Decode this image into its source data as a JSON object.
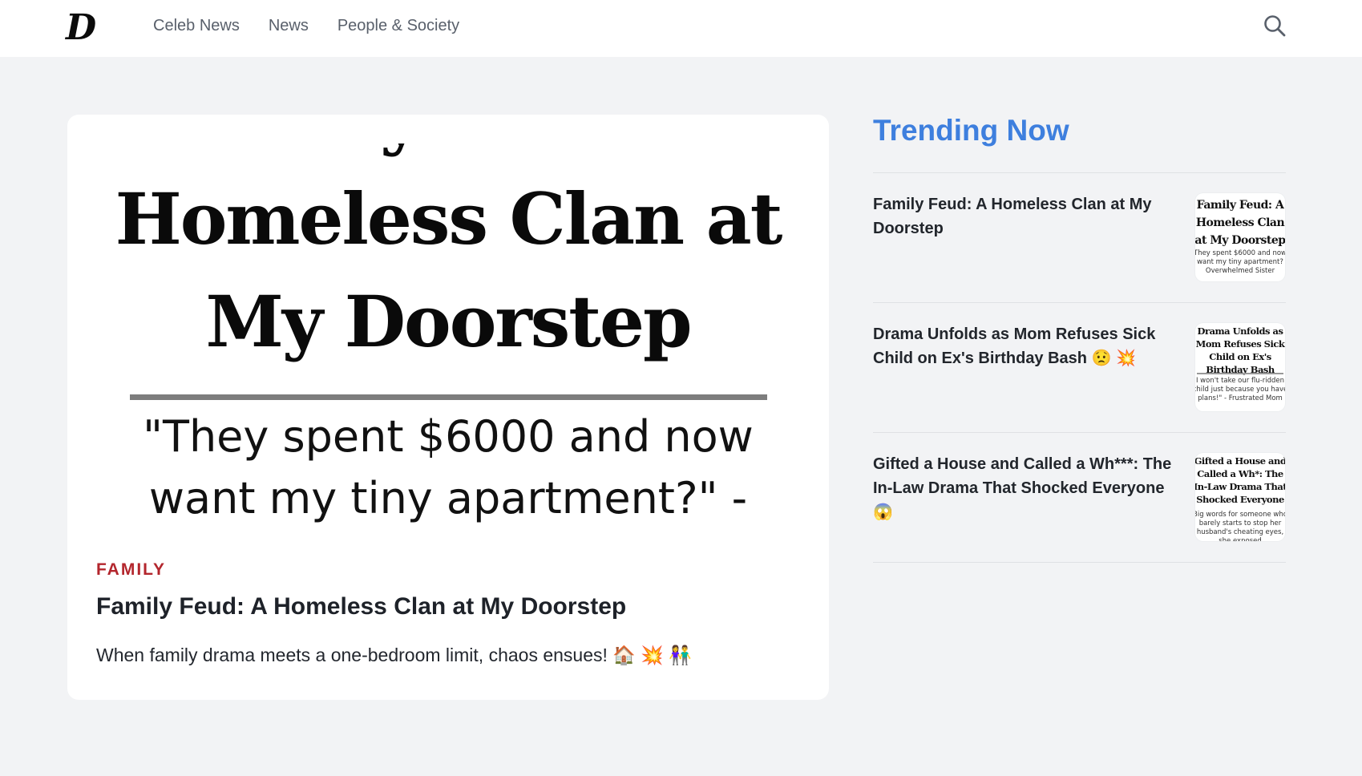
{
  "header": {
    "logo_text": "D",
    "nav": [
      {
        "label": "Celeb News"
      },
      {
        "label": "News"
      },
      {
        "label": "People & Society"
      }
    ],
    "search_icon": "search-icon"
  },
  "featured": {
    "hero": {
      "title": "Family Feud: A Homeless Clan at My Doorstep",
      "quote": "\"They spent $6000 and now want my tiny apartment?\" -"
    },
    "category": "FAMILY",
    "title": "Family Feud: A Homeless Clan at My Doorstep",
    "description": "When family drama meets a one-bedroom limit, chaos ensues! 🏠 💥 👫"
  },
  "trending": {
    "heading": "Trending Now",
    "items": [
      {
        "title": "Family Feud: A Homeless Clan at My Doorstep",
        "thumb_title": "Family Feud: A Homeless Clan at My Doorstep",
        "thumb_sub": "They spent $6000 and now want my tiny apartment? Overwhelmed Sister"
      },
      {
        "title": "Drama Unfolds as Mom Refuses Sick Child on Ex's Birthday Bash 😟 💥",
        "thumb_title": "Drama Unfolds as Mom Refuses Sick Child on Ex's Birthday Bash",
        "thumb_sub": "I won't take our flu-ridden child just because you have plans!\" - Frustrated Mom"
      },
      {
        "title": "Gifted a House and Called a Wh***: The In-Law Drama That Shocked Everyone 😱",
        "thumb_title": "Gifted a House and Called a Wh*: The In-Law Drama That Shocked Everyone",
        "thumb_sub": "Big words for someone who barely starts to stop her husband's cheating eyes, she exposed"
      }
    ]
  }
}
